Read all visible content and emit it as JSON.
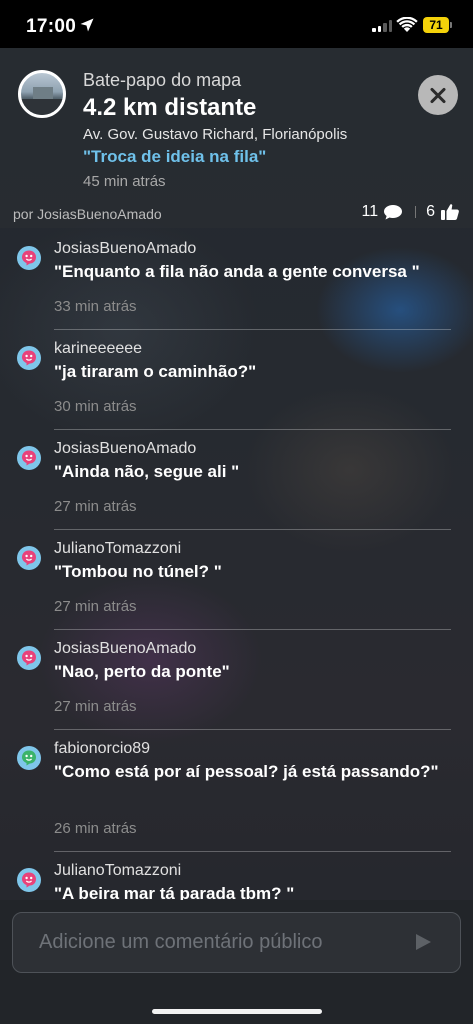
{
  "status_bar": {
    "time": "17:00",
    "battery": "71"
  },
  "header": {
    "chat_title": "Bate-papo do mapa",
    "distance": "4.2 km distante",
    "address": "Av. Gov. Gustavo Richard, Florianópolis",
    "topic": "\"Troca de ideia na fila\"",
    "posted_time": "45 min atrás",
    "author": "por JosiasBuenoAmado",
    "comment_count": "11",
    "like_count": "6"
  },
  "messages": [
    {
      "user": "JosiasBuenoAmado",
      "text": "\"Enquanto a fila não anda a gente conversa \"",
      "time": "33 min atrás",
      "avatar_color": "#7fc6ea",
      "avatar_face": "#e8427a"
    },
    {
      "user": "karineeeeee",
      "text": "\"ja tiraram o caminhão?\"",
      "time": "30 min atrás",
      "avatar_color": "#7fc6ea",
      "avatar_face": "#e8427a"
    },
    {
      "user": "JosiasBuenoAmado",
      "text": "\"Ainda não, segue ali \"",
      "time": "27 min atrás",
      "avatar_color": "#7fc6ea",
      "avatar_face": "#e8427a"
    },
    {
      "user": "JulianoTomazzoni",
      "text": "\"Tombou no túnel? \"",
      "time": "27 min atrás",
      "avatar_color": "#7fc6ea",
      "avatar_face": "#e8427a"
    },
    {
      "user": "JosiasBuenoAmado",
      "text": "\"Nao, perto da ponte\"",
      "time": "27 min atrás",
      "avatar_color": "#7fc6ea",
      "avatar_face": "#e8427a"
    },
    {
      "user": "fabionorcio89",
      "text": "\"Como está por aí pessoal? já está passando?\"",
      "time": "26 min atrás",
      "avatar_color": "#7fc6ea",
      "avatar_face": "#3bb36a"
    },
    {
      "user": "JulianoTomazzoni",
      "text": "\"A beira mar tá parada tbm? \"",
      "time": "",
      "avatar_color": "#7fc6ea",
      "avatar_face": "#e8427a"
    }
  ],
  "input": {
    "placeholder": "Adicione um comentário público"
  },
  "colors": {
    "accent_topic": "#6fc1ea",
    "battery": "#f4d20a"
  }
}
